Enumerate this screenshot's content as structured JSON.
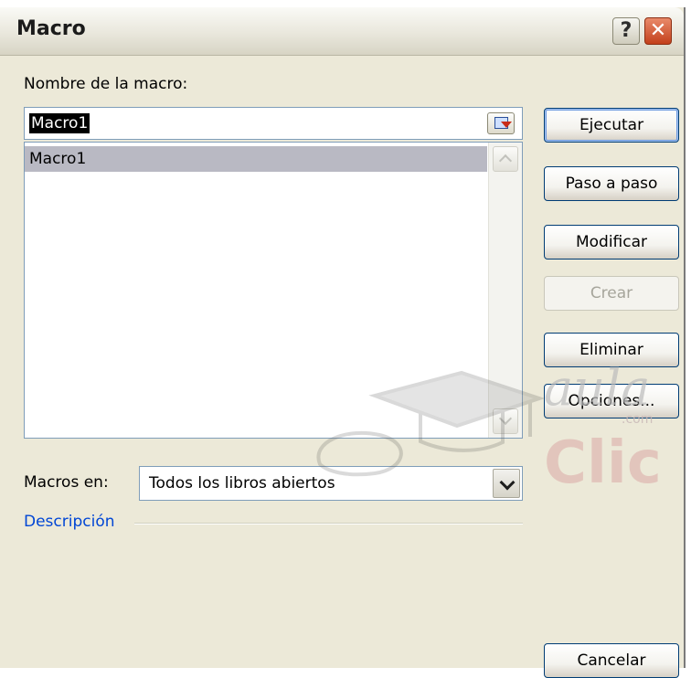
{
  "window": {
    "title": "Macro"
  },
  "titlebar_buttons": {
    "help": "?",
    "close": "✕"
  },
  "name_section": {
    "label": "Nombre de la macro:",
    "value": "Macro1"
  },
  "macro_list": {
    "items": [
      "Macro1"
    ]
  },
  "buttons": {
    "run": "Ejecutar",
    "step": "Paso a paso",
    "edit": "Modificar",
    "create": "Crear",
    "delete": "Eliminar",
    "options": "Opciones...",
    "cancel": "Cancelar"
  },
  "macros_in": {
    "label": "Macros en:",
    "value": "Todos los libros abiertos"
  },
  "description": {
    "label": "Descripción"
  },
  "watermark": {
    "text": "aula Clic",
    "sub": ".com"
  },
  "colors": {
    "dialog_bg": "#ece9d8",
    "accent_blue": "#0046d5",
    "selection": "#b9b9c3"
  }
}
